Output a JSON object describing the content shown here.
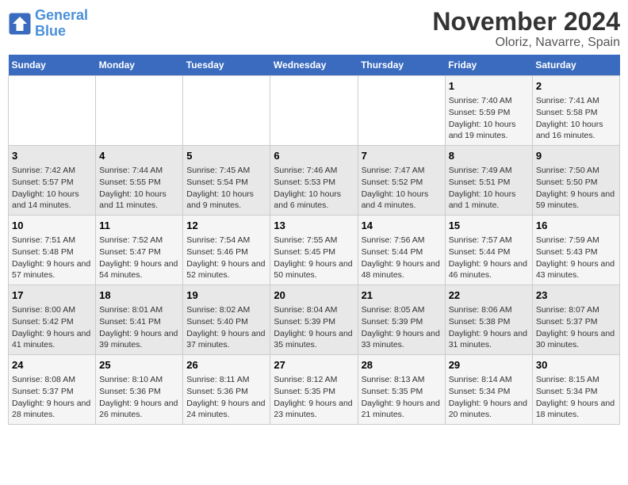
{
  "header": {
    "logo_line1": "General",
    "logo_line2": "Blue",
    "title": "November 2024",
    "subtitle": "Oloriz, Navarre, Spain"
  },
  "days_of_week": [
    "Sunday",
    "Monday",
    "Tuesday",
    "Wednesday",
    "Thursday",
    "Friday",
    "Saturday"
  ],
  "weeks": [
    [
      {
        "day": "",
        "info": ""
      },
      {
        "day": "",
        "info": ""
      },
      {
        "day": "",
        "info": ""
      },
      {
        "day": "",
        "info": ""
      },
      {
        "day": "",
        "info": ""
      },
      {
        "day": "1",
        "info": "Sunrise: 7:40 AM\nSunset: 5:59 PM\nDaylight: 10 hours and 19 minutes."
      },
      {
        "day": "2",
        "info": "Sunrise: 7:41 AM\nSunset: 5:58 PM\nDaylight: 10 hours and 16 minutes."
      }
    ],
    [
      {
        "day": "3",
        "info": "Sunrise: 7:42 AM\nSunset: 5:57 PM\nDaylight: 10 hours and 14 minutes."
      },
      {
        "day": "4",
        "info": "Sunrise: 7:44 AM\nSunset: 5:55 PM\nDaylight: 10 hours and 11 minutes."
      },
      {
        "day": "5",
        "info": "Sunrise: 7:45 AM\nSunset: 5:54 PM\nDaylight: 10 hours and 9 minutes."
      },
      {
        "day": "6",
        "info": "Sunrise: 7:46 AM\nSunset: 5:53 PM\nDaylight: 10 hours and 6 minutes."
      },
      {
        "day": "7",
        "info": "Sunrise: 7:47 AM\nSunset: 5:52 PM\nDaylight: 10 hours and 4 minutes."
      },
      {
        "day": "8",
        "info": "Sunrise: 7:49 AM\nSunset: 5:51 PM\nDaylight: 10 hours and 1 minute."
      },
      {
        "day": "9",
        "info": "Sunrise: 7:50 AM\nSunset: 5:50 PM\nDaylight: 9 hours and 59 minutes."
      }
    ],
    [
      {
        "day": "10",
        "info": "Sunrise: 7:51 AM\nSunset: 5:48 PM\nDaylight: 9 hours and 57 minutes."
      },
      {
        "day": "11",
        "info": "Sunrise: 7:52 AM\nSunset: 5:47 PM\nDaylight: 9 hours and 54 minutes."
      },
      {
        "day": "12",
        "info": "Sunrise: 7:54 AM\nSunset: 5:46 PM\nDaylight: 9 hours and 52 minutes."
      },
      {
        "day": "13",
        "info": "Sunrise: 7:55 AM\nSunset: 5:45 PM\nDaylight: 9 hours and 50 minutes."
      },
      {
        "day": "14",
        "info": "Sunrise: 7:56 AM\nSunset: 5:44 PM\nDaylight: 9 hours and 48 minutes."
      },
      {
        "day": "15",
        "info": "Sunrise: 7:57 AM\nSunset: 5:44 PM\nDaylight: 9 hours and 46 minutes."
      },
      {
        "day": "16",
        "info": "Sunrise: 7:59 AM\nSunset: 5:43 PM\nDaylight: 9 hours and 43 minutes."
      }
    ],
    [
      {
        "day": "17",
        "info": "Sunrise: 8:00 AM\nSunset: 5:42 PM\nDaylight: 9 hours and 41 minutes."
      },
      {
        "day": "18",
        "info": "Sunrise: 8:01 AM\nSunset: 5:41 PM\nDaylight: 9 hours and 39 minutes."
      },
      {
        "day": "19",
        "info": "Sunrise: 8:02 AM\nSunset: 5:40 PM\nDaylight: 9 hours and 37 minutes."
      },
      {
        "day": "20",
        "info": "Sunrise: 8:04 AM\nSunset: 5:39 PM\nDaylight: 9 hours and 35 minutes."
      },
      {
        "day": "21",
        "info": "Sunrise: 8:05 AM\nSunset: 5:39 PM\nDaylight: 9 hours and 33 minutes."
      },
      {
        "day": "22",
        "info": "Sunrise: 8:06 AM\nSunset: 5:38 PM\nDaylight: 9 hours and 31 minutes."
      },
      {
        "day": "23",
        "info": "Sunrise: 8:07 AM\nSunset: 5:37 PM\nDaylight: 9 hours and 30 minutes."
      }
    ],
    [
      {
        "day": "24",
        "info": "Sunrise: 8:08 AM\nSunset: 5:37 PM\nDaylight: 9 hours and 28 minutes."
      },
      {
        "day": "25",
        "info": "Sunrise: 8:10 AM\nSunset: 5:36 PM\nDaylight: 9 hours and 26 minutes."
      },
      {
        "day": "26",
        "info": "Sunrise: 8:11 AM\nSunset: 5:36 PM\nDaylight: 9 hours and 24 minutes."
      },
      {
        "day": "27",
        "info": "Sunrise: 8:12 AM\nSunset: 5:35 PM\nDaylight: 9 hours and 23 minutes."
      },
      {
        "day": "28",
        "info": "Sunrise: 8:13 AM\nSunset: 5:35 PM\nDaylight: 9 hours and 21 minutes."
      },
      {
        "day": "29",
        "info": "Sunrise: 8:14 AM\nSunset: 5:34 PM\nDaylight: 9 hours and 20 minutes."
      },
      {
        "day": "30",
        "info": "Sunrise: 8:15 AM\nSunset: 5:34 PM\nDaylight: 9 hours and 18 minutes."
      }
    ]
  ]
}
